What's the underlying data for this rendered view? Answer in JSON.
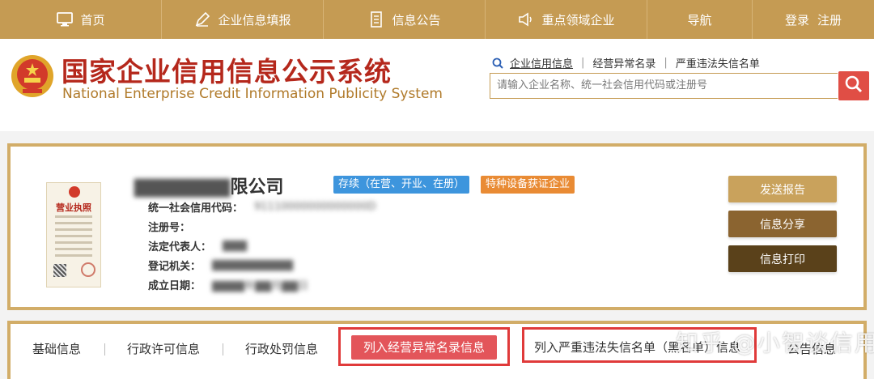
{
  "nav": {
    "home": "首页",
    "fill_info": "企业信息填报",
    "announcement": "信息公告",
    "key_industry": "重点领域企业",
    "navigation": "导航",
    "login": "登录",
    "register": "注册"
  },
  "header": {
    "title_cn": "国家企业信用信息公示系统",
    "title_en": "National Enterprise Credit Information Publicity System"
  },
  "search": {
    "tabs": [
      "企业信用信息",
      "经营异常名录",
      "严重违法失信名单"
    ],
    "placeholder": "请输入企业名称、统一社会信用代码或注册号"
  },
  "company": {
    "name_visible": "限公司",
    "name_obscured": "▇▇▇▇▇▇▇",
    "status_badge": "存续（在营、开业、在册）",
    "special_badge": "特种设备获证企业",
    "fields": [
      {
        "label": "统一社会信用代码：",
        "value": "91110000000000000D"
      },
      {
        "label": "注册号：",
        "value": ""
      },
      {
        "label": "法定代表人：",
        "value": "▇▇▇"
      },
      {
        "label": "登记机关：",
        "value": "▇▇▇▇▇▇▇▇▇▇"
      },
      {
        "label": "成立日期：",
        "value": "▇▇▇▇年▇▇月▇▇日"
      }
    ],
    "license_label": "营业执照"
  },
  "actions": {
    "send_report": "发送报告",
    "share": "信息分享",
    "print": "信息打印"
  },
  "tabs": {
    "basic": "基础信息",
    "permit": "行政许可信息",
    "penalty": "行政处罚信息",
    "abnormal": "列入经营异常名录信息",
    "blacklist": "列入严重违法失信名单（黑名单）信息",
    "last": "公告信息"
  },
  "watermark": "知乎 @小智谈信用",
  "colors": {
    "nav_gold": "#c59b53",
    "title_red": "#b5281c",
    "status_blue": "#3d95dd",
    "special_orange": "#e98b34",
    "search_red": "#e04e45",
    "highlight_red": "#e03a3a"
  }
}
